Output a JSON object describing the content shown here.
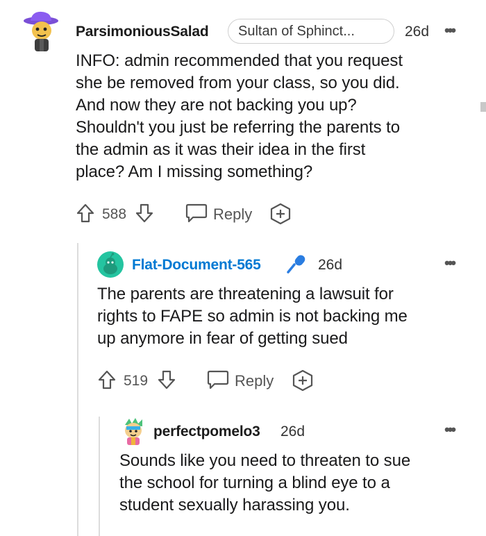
{
  "comments": [
    {
      "username": "ParsimoniousSalad",
      "flair": "Sultan of Sphinct...",
      "age": "26d",
      "lines": [
        "INFO: admin recommended that you request",
        "she be removed from your class, so you did.",
        "And now they are not backing you up?",
        "Shouldn't you just be referring the parents to",
        "the admin as it was their idea in the first",
        "place? Am I missing something?"
      ],
      "votes": "588",
      "reply_label": "Reply"
    },
    {
      "username": "Flat-Document-565",
      "is_op": true,
      "age": "26d",
      "lines": [
        "The parents are threatening a lawsuit for",
        "rights to FAPE so admin is not backing me",
        "up anymore in fear of getting sued"
      ],
      "votes": "519",
      "reply_label": "Reply"
    },
    {
      "username": "perfectpomelo3",
      "age": "26d",
      "lines": [
        "Sounds like you need to threaten to sue",
        "the school for turning a blind eye to a",
        "student sexually harassing you."
      ]
    }
  ],
  "more_menu": "•••",
  "colors": {
    "op_blue": "#0079d3",
    "accent_teal": "#24c4a0",
    "mic_blue": "#2a7de1"
  }
}
